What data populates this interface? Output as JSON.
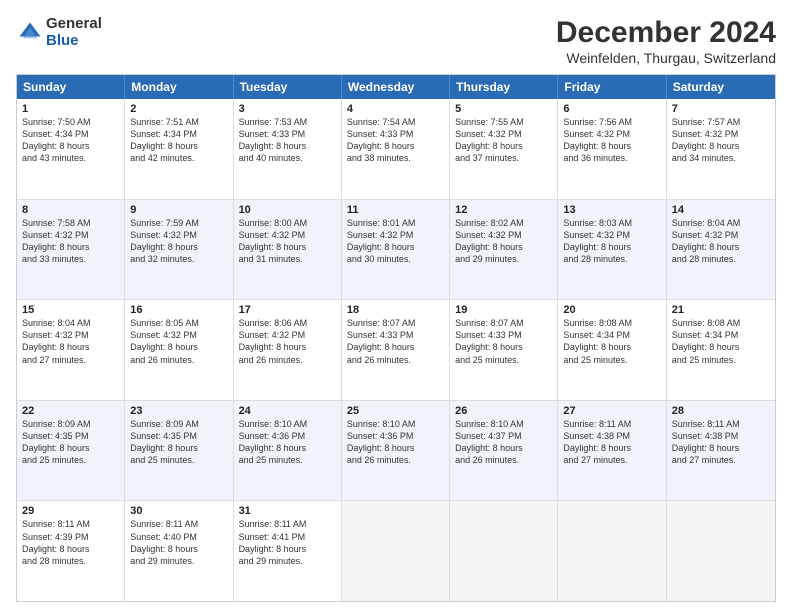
{
  "logo": {
    "general": "General",
    "blue": "Blue"
  },
  "title": "December 2024",
  "location": "Weinfelden, Thurgau, Switzerland",
  "days": [
    "Sunday",
    "Monday",
    "Tuesday",
    "Wednesday",
    "Thursday",
    "Friday",
    "Saturday"
  ],
  "weeks": [
    [
      {
        "day": "1",
        "rise": "Sunrise: 7:50 AM",
        "set": "Sunset: 4:34 PM",
        "light": "Daylight: 8 hours and 43 minutes."
      },
      {
        "day": "2",
        "rise": "Sunrise: 7:51 AM",
        "set": "Sunset: 4:34 PM",
        "light": "Daylight: 8 hours and 42 minutes."
      },
      {
        "day": "3",
        "rise": "Sunrise: 7:53 AM",
        "set": "Sunset: 4:33 PM",
        "light": "Daylight: 8 hours and 40 minutes."
      },
      {
        "day": "4",
        "rise": "Sunrise: 7:54 AM",
        "set": "Sunset: 4:33 PM",
        "light": "Daylight: 8 hours and 38 minutes."
      },
      {
        "day": "5",
        "rise": "Sunrise: 7:55 AM",
        "set": "Sunset: 4:32 PM",
        "light": "Daylight: 8 hours and 37 minutes."
      },
      {
        "day": "6",
        "rise": "Sunrise: 7:56 AM",
        "set": "Sunset: 4:32 PM",
        "light": "Daylight: 8 hours and 36 minutes."
      },
      {
        "day": "7",
        "rise": "Sunrise: 7:57 AM",
        "set": "Sunset: 4:32 PM",
        "light": "Daylight: 8 hours and 34 minutes."
      }
    ],
    [
      {
        "day": "8",
        "rise": "Sunrise: 7:58 AM",
        "set": "Sunset: 4:32 PM",
        "light": "Daylight: 8 hours and 33 minutes."
      },
      {
        "day": "9",
        "rise": "Sunrise: 7:59 AM",
        "set": "Sunset: 4:32 PM",
        "light": "Daylight: 8 hours and 32 minutes."
      },
      {
        "day": "10",
        "rise": "Sunrise: 8:00 AM",
        "set": "Sunset: 4:32 PM",
        "light": "Daylight: 8 hours and 31 minutes."
      },
      {
        "day": "11",
        "rise": "Sunrise: 8:01 AM",
        "set": "Sunset: 4:32 PM",
        "light": "Daylight: 8 hours and 30 minutes."
      },
      {
        "day": "12",
        "rise": "Sunrise: 8:02 AM",
        "set": "Sunset: 4:32 PM",
        "light": "Daylight: 8 hours and 29 minutes."
      },
      {
        "day": "13",
        "rise": "Sunrise: 8:03 AM",
        "set": "Sunset: 4:32 PM",
        "light": "Daylight: 8 hours and 28 minutes."
      },
      {
        "day": "14",
        "rise": "Sunrise: 8:04 AM",
        "set": "Sunset: 4:32 PM",
        "light": "Daylight: 8 hours and 28 minutes."
      }
    ],
    [
      {
        "day": "15",
        "rise": "Sunrise: 8:04 AM",
        "set": "Sunset: 4:32 PM",
        "light": "Daylight: 8 hours and 27 minutes."
      },
      {
        "day": "16",
        "rise": "Sunrise: 8:05 AM",
        "set": "Sunset: 4:32 PM",
        "light": "Daylight: 8 hours and 26 minutes."
      },
      {
        "day": "17",
        "rise": "Sunrise: 8:06 AM",
        "set": "Sunset: 4:32 PM",
        "light": "Daylight: 8 hours and 26 minutes."
      },
      {
        "day": "18",
        "rise": "Sunrise: 8:07 AM",
        "set": "Sunset: 4:33 PM",
        "light": "Daylight: 8 hours and 26 minutes."
      },
      {
        "day": "19",
        "rise": "Sunrise: 8:07 AM",
        "set": "Sunset: 4:33 PM",
        "light": "Daylight: 8 hours and 25 minutes."
      },
      {
        "day": "20",
        "rise": "Sunrise: 8:08 AM",
        "set": "Sunset: 4:34 PM",
        "light": "Daylight: 8 hours and 25 minutes."
      },
      {
        "day": "21",
        "rise": "Sunrise: 8:08 AM",
        "set": "Sunset: 4:34 PM",
        "light": "Daylight: 8 hours and 25 minutes."
      }
    ],
    [
      {
        "day": "22",
        "rise": "Sunrise: 8:09 AM",
        "set": "Sunset: 4:35 PM",
        "light": "Daylight: 8 hours and 25 minutes."
      },
      {
        "day": "23",
        "rise": "Sunrise: 8:09 AM",
        "set": "Sunset: 4:35 PM",
        "light": "Daylight: 8 hours and 25 minutes."
      },
      {
        "day": "24",
        "rise": "Sunrise: 8:10 AM",
        "set": "Sunset: 4:36 PM",
        "light": "Daylight: 8 hours and 25 minutes."
      },
      {
        "day": "25",
        "rise": "Sunrise: 8:10 AM",
        "set": "Sunset: 4:36 PM",
        "light": "Daylight: 8 hours and 26 minutes."
      },
      {
        "day": "26",
        "rise": "Sunrise: 8:10 AM",
        "set": "Sunset: 4:37 PM",
        "light": "Daylight: 8 hours and 26 minutes."
      },
      {
        "day": "27",
        "rise": "Sunrise: 8:11 AM",
        "set": "Sunset: 4:38 PM",
        "light": "Daylight: 8 hours and 27 minutes."
      },
      {
        "day": "28",
        "rise": "Sunrise: 8:11 AM",
        "set": "Sunset: 4:38 PM",
        "light": "Daylight: 8 hours and 27 minutes."
      }
    ],
    [
      {
        "day": "29",
        "rise": "Sunrise: 8:11 AM",
        "set": "Sunset: 4:39 PM",
        "light": "Daylight: 8 hours and 28 minutes."
      },
      {
        "day": "30",
        "rise": "Sunrise: 8:11 AM",
        "set": "Sunset: 4:40 PM",
        "light": "Daylight: 8 hours and 29 minutes."
      },
      {
        "day": "31",
        "rise": "Sunrise: 8:11 AM",
        "set": "Sunset: 4:41 PM",
        "light": "Daylight: 8 hours and 29 minutes."
      },
      null,
      null,
      null,
      null
    ]
  ],
  "alt_rows": [
    1,
    3
  ]
}
